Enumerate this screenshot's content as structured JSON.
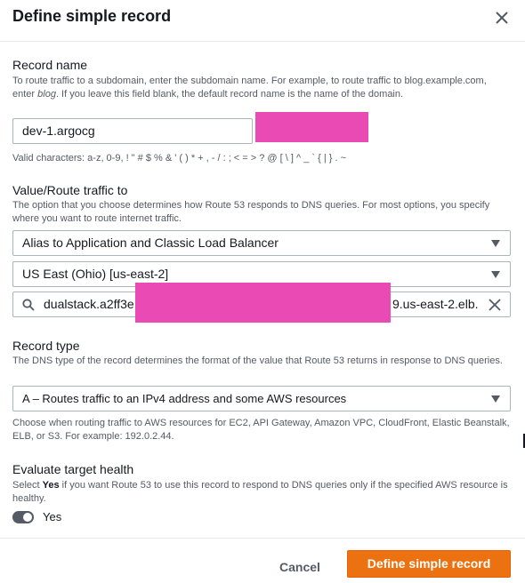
{
  "modal": {
    "title": "Define simple record",
    "close_icon": "close-icon"
  },
  "record_name": {
    "label": "Record name",
    "description_pre": "To route traffic to a subdomain, enter the subdomain name. For example, to route traffic to blog.example.com, enter ",
    "description_em": "blog",
    "description_post": ". If you leave this field blank, the default record name is the name of the domain.",
    "value": "dev-1.argocg",
    "valid_chars": "Valid characters: a-z, 0-9, ! \" # $ % & ' ( ) * + , - / : ; < = > ? @ [ \\ ] ^ _ ` { | } . ~"
  },
  "route_traffic": {
    "label": "Value/Route traffic to",
    "description": "The option that you choose determines how Route 53 responds to DNS queries. For most options, you specify where you want to route internet traffic.",
    "endpoint_select": "Alias to Application and Classic Load Balancer",
    "region_select": "US East (Ohio) [us-east-2]",
    "lb_value_start": "dualstack.a2ff3e",
    "lb_value_end": "9.us-east-2.elb."
  },
  "record_type": {
    "label": "Record type",
    "description": "The DNS type of the record determines the format of the value that Route 53 returns in response to DNS queries.",
    "select": "A – Routes traffic to an IPv4 address and some AWS resources",
    "hint": "Choose when routing traffic to AWS resources for EC2, API Gateway, Amazon VPC, CloudFront, Elastic Beanstalk, ELB, or S3. For example: 192.0.2.44."
  },
  "health": {
    "label": "Evaluate target health",
    "description_pre": "Select ",
    "description_bold": "Yes",
    "description_post": " if you want Route 53 to use this record to respond to DNS queries only if the specified AWS resource is healthy.",
    "toggle_label": "Yes",
    "toggle_on": true
  },
  "footer": {
    "cancel_label": "Cancel",
    "submit_label": "Define simple record"
  },
  "colors": {
    "primary": "#ec7211",
    "redaction": "#ea4ab4",
    "text": "#16191f",
    "muted": "#545b64"
  }
}
